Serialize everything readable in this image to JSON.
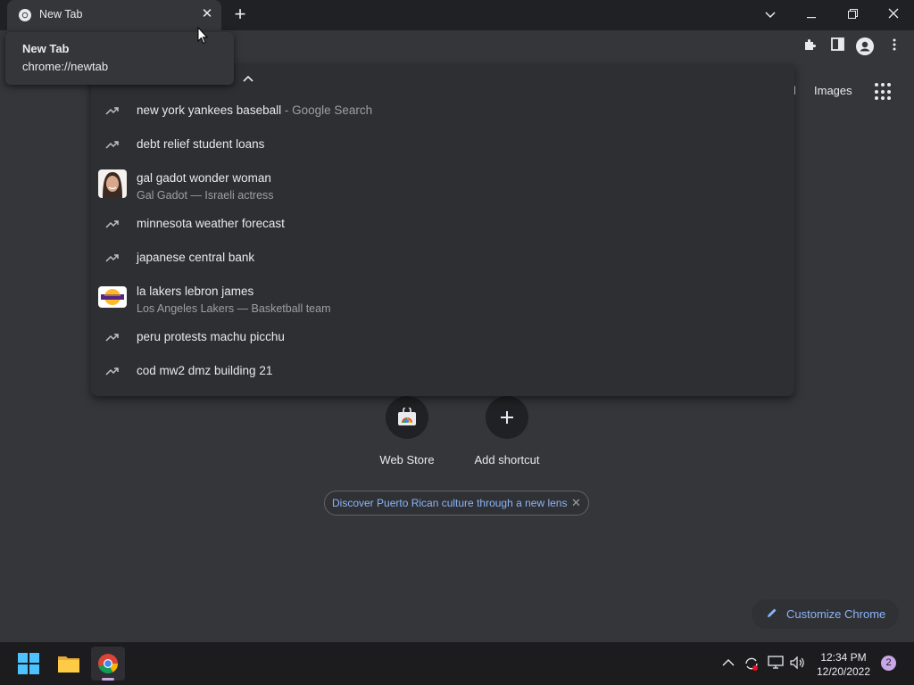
{
  "tab": {
    "title": "New Tab",
    "close_glyph": "✕",
    "new_tab_glyph": "+"
  },
  "window_controls": {
    "tab_search": "⌄",
    "minimize": "—",
    "restore": "❐",
    "close": "✕"
  },
  "hover_card": {
    "title": "New Tab",
    "url": "chrome://newtab"
  },
  "toolbar": {
    "icons": [
      "extensions-icon",
      "side-panel-icon",
      "profile-icon",
      "menu-icon"
    ]
  },
  "ntp": {
    "links": {
      "gmail_partial": "il",
      "images": "Images"
    },
    "shortcuts": [
      {
        "label": "Web Store"
      },
      {
        "label": "Add shortcut"
      }
    ],
    "promo": {
      "text": "Discover Puerto Rican culture through a new lens",
      "close": "✕"
    },
    "customize": {
      "label": "Customize Chrome"
    }
  },
  "omnibox_dropdown": {
    "suggestions": [
      {
        "text": "new york yankees baseball",
        "suffix": " - Google Search",
        "icon": "trending-icon"
      },
      {
        "text": "debt relief student loans",
        "icon": "trending-icon"
      },
      {
        "text": "gal gadot wonder woman",
        "sub": "Gal Gadot — Israeli actress",
        "icon": "entity-image"
      },
      {
        "text": "minnesota weather forecast",
        "icon": "trending-icon"
      },
      {
        "text": "japanese central bank",
        "icon": "trending-icon"
      },
      {
        "text": "la lakers lebron james",
        "sub": "Los Angeles Lakers — Basketball team",
        "icon": "entity-image"
      },
      {
        "text": "peru protests machu picchu",
        "icon": "trending-icon"
      },
      {
        "text": "cod mw2 dmz building 21",
        "icon": "trending-icon"
      }
    ]
  },
  "taskbar": {
    "apps": [
      "windows-start-icon",
      "file-explorer-icon",
      "chrome-icon"
    ],
    "tray_chevron": "^",
    "time": "12:34 PM",
    "date": "12/20/2022",
    "notification_count": "2"
  },
  "colors": {
    "accent": "#8ab4f8",
    "background": "#35363a",
    "dropdown": "#2e2f33",
    "taskbar": "#1c1c1f"
  }
}
